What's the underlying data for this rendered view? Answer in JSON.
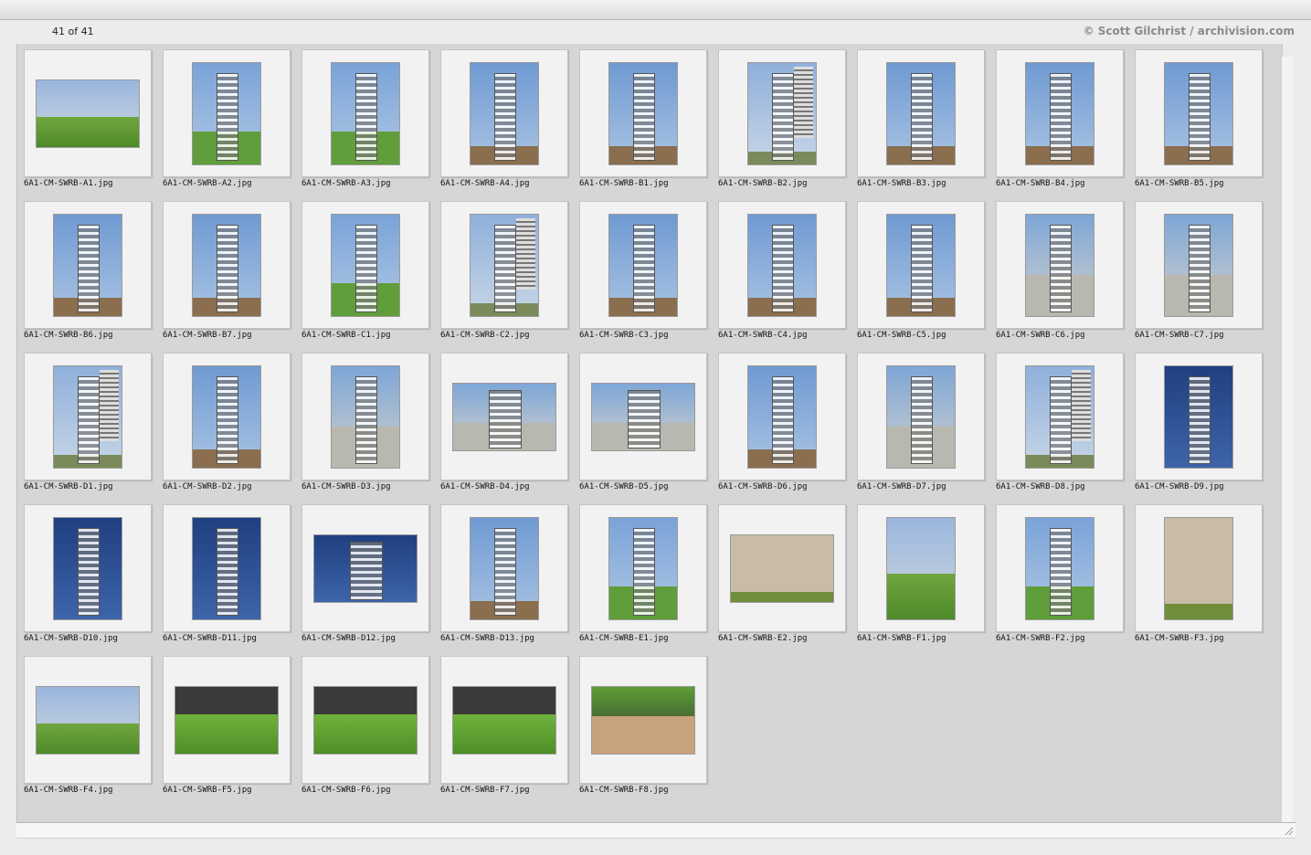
{
  "header": {
    "count": "41 of 41",
    "credit": "© Scott Gilchrist / archivision.com"
  },
  "images": [
    {
      "filename": "6A1-CM-SWRB-A1.jpg",
      "orientation": "landscape",
      "scene": "plaza"
    },
    {
      "filename": "6A1-CM-SWRB-A2.jpg",
      "orientation": "portrait",
      "scene": "tower-grass"
    },
    {
      "filename": "6A1-CM-SWRB-A3.jpg",
      "orientation": "portrait",
      "scene": "tower-grass"
    },
    {
      "filename": "6A1-CM-SWRB-A4.jpg",
      "orientation": "portrait",
      "scene": "tower-sky"
    },
    {
      "filename": "6A1-CM-SWRB-B1.jpg",
      "orientation": "portrait",
      "scene": "tower-sky"
    },
    {
      "filename": "6A1-CM-SWRB-B2.jpg",
      "orientation": "portrait",
      "scene": "building"
    },
    {
      "filename": "6A1-CM-SWRB-B3.jpg",
      "orientation": "portrait",
      "scene": "tower-sky"
    },
    {
      "filename": "6A1-CM-SWRB-B4.jpg",
      "orientation": "portrait",
      "scene": "tower-sky"
    },
    {
      "filename": "6A1-CM-SWRB-B5.jpg",
      "orientation": "portrait",
      "scene": "tower-sky"
    },
    {
      "filename": "6A1-CM-SWRB-B6.jpg",
      "orientation": "portrait",
      "scene": "tower-sky"
    },
    {
      "filename": "6A1-CM-SWRB-B7.jpg",
      "orientation": "portrait",
      "scene": "tower-sky"
    },
    {
      "filename": "6A1-CM-SWRB-C1.jpg",
      "orientation": "portrait",
      "scene": "tower-grass"
    },
    {
      "filename": "6A1-CM-SWRB-C2.jpg",
      "orientation": "portrait",
      "scene": "building"
    },
    {
      "filename": "6A1-CM-SWRB-C3.jpg",
      "orientation": "portrait",
      "scene": "tower-sky"
    },
    {
      "filename": "6A1-CM-SWRB-C4.jpg",
      "orientation": "portrait",
      "scene": "tower-sky"
    },
    {
      "filename": "6A1-CM-SWRB-C5.jpg",
      "orientation": "portrait",
      "scene": "tower-sky"
    },
    {
      "filename": "6A1-CM-SWRB-C6.jpg",
      "orientation": "portrait",
      "scene": "steel"
    },
    {
      "filename": "6A1-CM-SWRB-C7.jpg",
      "orientation": "portrait",
      "scene": "steel"
    },
    {
      "filename": "6A1-CM-SWRB-D1.jpg",
      "orientation": "portrait",
      "scene": "building"
    },
    {
      "filename": "6A1-CM-SWRB-D2.jpg",
      "orientation": "portrait",
      "scene": "tower-sky"
    },
    {
      "filename": "6A1-CM-SWRB-D3.jpg",
      "orientation": "portrait",
      "scene": "steel"
    },
    {
      "filename": "6A1-CM-SWRB-D4.jpg",
      "orientation": "landscape",
      "scene": "steel"
    },
    {
      "filename": "6A1-CM-SWRB-D5.jpg",
      "orientation": "landscape",
      "scene": "steel"
    },
    {
      "filename": "6A1-CM-SWRB-D6.jpg",
      "orientation": "portrait",
      "scene": "tower-sky"
    },
    {
      "filename": "6A1-CM-SWRB-D7.jpg",
      "orientation": "portrait",
      "scene": "steel"
    },
    {
      "filename": "6A1-CM-SWRB-D8.jpg",
      "orientation": "portrait",
      "scene": "building"
    },
    {
      "filename": "6A1-CM-SWRB-D9.jpg",
      "orientation": "portrait",
      "scene": "deep-sky"
    },
    {
      "filename": "6A1-CM-SWRB-D10.jpg",
      "orientation": "portrait",
      "scene": "deep-sky"
    },
    {
      "filename": "6A1-CM-SWRB-D11.jpg",
      "orientation": "portrait",
      "scene": "deep-sky"
    },
    {
      "filename": "6A1-CM-SWRB-D12.jpg",
      "orientation": "landscape",
      "scene": "deep-sky"
    },
    {
      "filename": "6A1-CM-SWRB-D13.jpg",
      "orientation": "portrait",
      "scene": "tower-sky"
    },
    {
      "filename": "6A1-CM-SWRB-E1.jpg",
      "orientation": "portrait",
      "scene": "tower-grass"
    },
    {
      "filename": "6A1-CM-SWRB-E2.jpg",
      "orientation": "landscape",
      "scene": "concrete"
    },
    {
      "filename": "6A1-CM-SWRB-F1.jpg",
      "orientation": "portrait",
      "scene": "plaza"
    },
    {
      "filename": "6A1-CM-SWRB-F2.jpg",
      "orientation": "portrait",
      "scene": "tower-grass"
    },
    {
      "filename": "6A1-CM-SWRB-F3.jpg",
      "orientation": "portrait",
      "scene": "concrete"
    },
    {
      "filename": "6A1-CM-SWRB-F4.jpg",
      "orientation": "landscape",
      "scene": "plaza"
    },
    {
      "filename": "6A1-CM-SWRB-F5.jpg",
      "orientation": "landscape",
      "scene": "lawn"
    },
    {
      "filename": "6A1-CM-SWRB-F6.jpg",
      "orientation": "landscape",
      "scene": "lawn"
    },
    {
      "filename": "6A1-CM-SWRB-F7.jpg",
      "orientation": "landscape",
      "scene": "lawn"
    },
    {
      "filename": "6A1-CM-SWRB-F8.jpg",
      "orientation": "landscape",
      "scene": "boardwalk"
    }
  ],
  "colors": {
    "sky": "#7fa8d8",
    "deep_sky": "#2a4f93",
    "grass": "#5f9e3a",
    "steel": "#b8b8b0",
    "concrete": "#b9ab95",
    "building": "#9c9c9c"
  }
}
